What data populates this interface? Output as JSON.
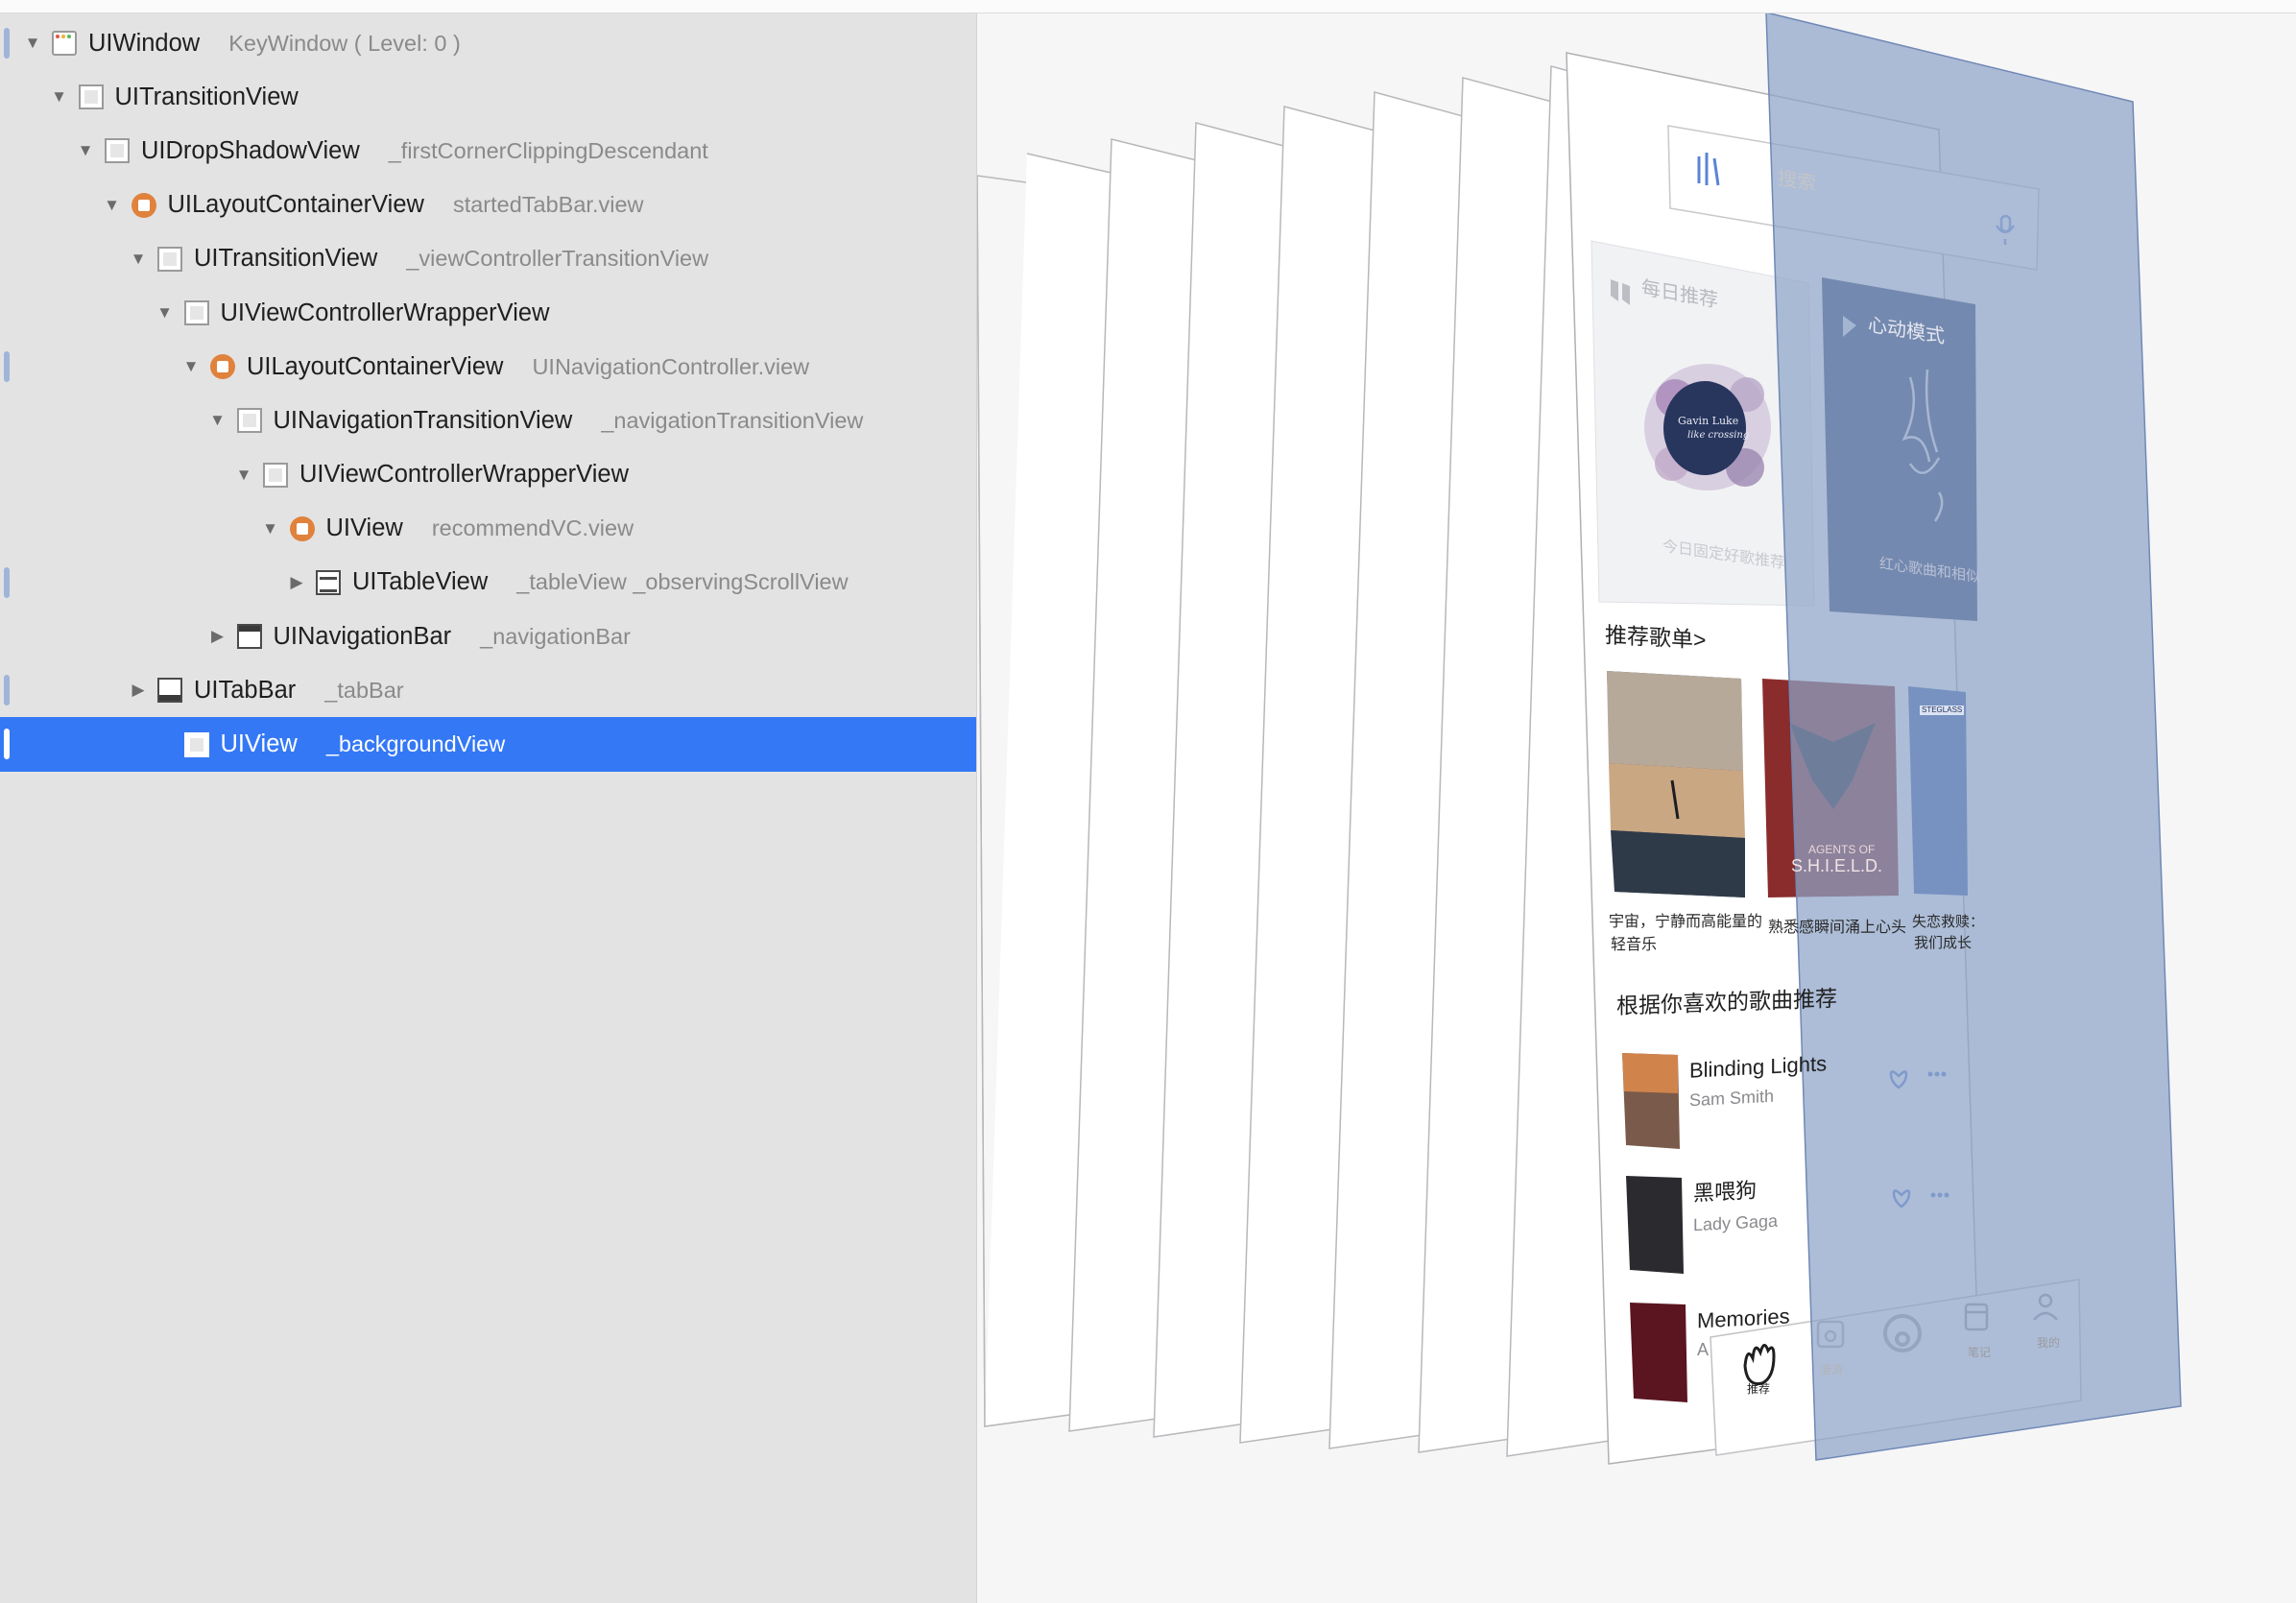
{
  "hierarchy": [
    {
      "cls": "UIWindow",
      "ann": "KeyWindow ( Level: 0 )",
      "icon": "window",
      "depth": 0,
      "disc": "open",
      "marker": true
    },
    {
      "cls": "UITransitionView",
      "ann": "",
      "icon": "view",
      "depth": 1,
      "disc": "open",
      "marker": false
    },
    {
      "cls": "UIDropShadowView",
      "ann": "_firstCornerClippingDescendant",
      "icon": "view",
      "depth": 2,
      "disc": "open",
      "marker": false
    },
    {
      "cls": "UILayoutContainerView",
      "ann": "startedTabBar.view",
      "icon": "container",
      "depth": 3,
      "disc": "open",
      "marker": false
    },
    {
      "cls": "UITransitionView",
      "ann": "_viewControllerTransitionView",
      "icon": "view",
      "depth": 4,
      "disc": "open",
      "marker": false
    },
    {
      "cls": "UIViewControllerWrapperView",
      "ann": "",
      "icon": "view",
      "depth": 5,
      "disc": "open",
      "marker": false
    },
    {
      "cls": "UILayoutContainerView",
      "ann": "UINavigationController.view",
      "icon": "container",
      "depth": 6,
      "disc": "open",
      "marker": true
    },
    {
      "cls": "UINavigationTransitionView",
      "ann": "_navigationTransitionView",
      "icon": "view",
      "depth": 7,
      "disc": "open",
      "marker": false
    },
    {
      "cls": "UIViewControllerWrapperView",
      "ann": "",
      "icon": "view",
      "depth": 8,
      "disc": "open",
      "marker": false
    },
    {
      "cls": "UIView",
      "ann": "recommendVC.view",
      "icon": "container",
      "depth": 9,
      "disc": "open",
      "marker": false
    },
    {
      "cls": "UITableView",
      "ann": "_tableView   _observingScrollView",
      "icon": "table",
      "depth": 10,
      "disc": "closed",
      "marker": true
    },
    {
      "cls": "UINavigationBar",
      "ann": "_navigationBar",
      "icon": "navbar",
      "depth": 7,
      "disc": "closed",
      "marker": false
    },
    {
      "cls": "UITabBar",
      "ann": "_tabBar",
      "icon": "tabbar",
      "depth": 4,
      "disc": "closed",
      "marker": true
    },
    {
      "cls": "UIView",
      "ann": "_backgroundView",
      "icon": "view",
      "depth": 5,
      "disc": "none",
      "marker": true,
      "selected": true
    }
  ],
  "phone": {
    "search_placeholder": "搜索",
    "card1_title": "每日推荐",
    "card1_subtitle": "今日固定好歌推荐",
    "card1_album_text": "Gavin Luke",
    "card1_album_sub": "like crossing",
    "card2_title": "心动模式",
    "card2_subtitle": "红心歌曲和相似",
    "playlist_header": "推荐歌单>",
    "playlists": [
      {
        "line1": "宇宙，宁静而高能量的",
        "line2": "轻音乐"
      },
      {
        "line1": "熟悉感瞬间涌上心头",
        "line2": "",
        "cover_text1": "AGENTS OF",
        "cover_text2": "S.H.I.E.L.D."
      },
      {
        "line1": "失恋救赎：",
        "line2": "我们成长",
        "tag": "STEGLASS"
      }
    ],
    "songs_header": "根据你喜欢的歌曲推荐",
    "songs": [
      {
        "title": "Blinding Lights",
        "artist": "Sam Smith"
      },
      {
        "title": "黑喂狗",
        "artist": "Lady Gaga"
      },
      {
        "title": "Memories",
        "artist": "A"
      }
    ],
    "tabs": [
      "推荐",
      "漫游",
      "",
      "笔记",
      "我的"
    ]
  },
  "colors": {
    "selection": "#3478f6",
    "container_icon": "#e0823c",
    "panel_bg": "#e3e3e4",
    "overlay": "#8ea3c8"
  }
}
